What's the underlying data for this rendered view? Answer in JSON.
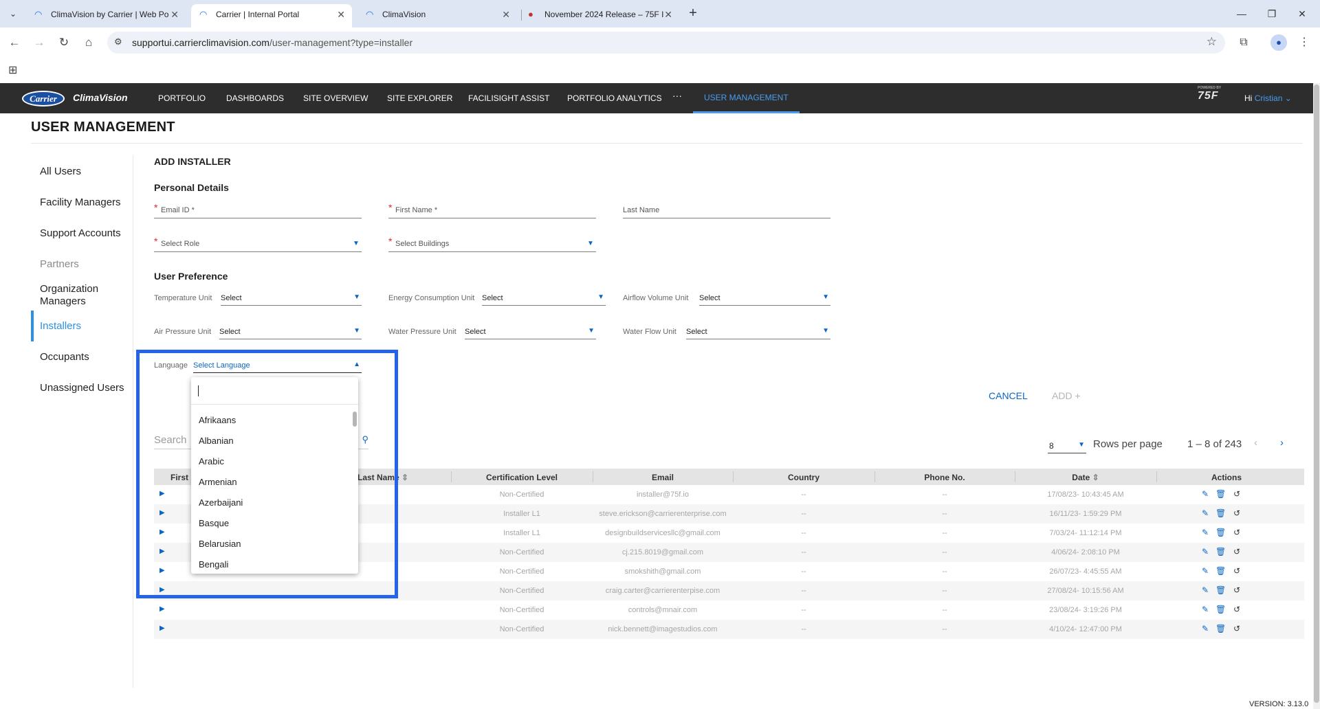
{
  "browser": {
    "tabs": [
      {
        "title": "ClimaVision by Carrier | Web Po",
        "active": false
      },
      {
        "title": "Carrier | Internal Portal",
        "active": true
      },
      {
        "title": "ClimaVision",
        "active": false
      },
      {
        "title": "November 2024 Release – 75F I",
        "active": false
      }
    ],
    "url_host": "supportui.carrierclimavision.com",
    "url_path": "/user-management?type=installer"
  },
  "app": {
    "logo_badge": "Carrier",
    "logo_text": "ClimaVision",
    "nav": [
      "PORTFOLIO",
      "DASHBOARDS",
      "SITE OVERVIEW",
      "SITE EXPLORER",
      "FACILISIGHT ASSIST",
      "PORTFOLIO ANALYTICS",
      "USER MANAGEMENT"
    ],
    "nav_more": "···",
    "active_nav": "USER MANAGEMENT",
    "brand_small": "POWERED BY",
    "brand": "75F",
    "greeting": "Hi",
    "user": "Cristian"
  },
  "page_title": "USER MANAGEMENT",
  "sidebar": {
    "items": [
      "All Users",
      "Facility Managers",
      "Support Accounts",
      "Partners",
      "Organization Managers",
      "Installers",
      "Occupants",
      "Unassigned Users"
    ],
    "active": "Installers"
  },
  "form": {
    "title": "ADD INSTALLER",
    "personal_heading": "Personal Details",
    "email_label": "Email ID *",
    "first_name_label": "First Name *",
    "last_name_label": "Last Name",
    "role_label": "Select Role",
    "buildings_label": "Select Buildings",
    "pref_heading": "User Preference",
    "temp_label": "Temperature Unit",
    "energy_label": "Energy Consumption Unit",
    "airflow_label": "Airflow Volume Unit",
    "air_pressure_label": "Air Pressure Unit",
    "water_pressure_label": "Water Pressure Unit",
    "water_flow_label": "Water Flow Unit",
    "select_value": "Select",
    "language_label": "Language",
    "language_value": "Select Language",
    "cancel": "CANCEL",
    "add": "ADD +"
  },
  "language_options": [
    "Afrikaans",
    "Albanian",
    "Arabic",
    "Armenian",
    "Azerbaijani",
    "Basque",
    "Belarusian",
    "Bengali"
  ],
  "table_controls": {
    "search_placeholder": "Search",
    "rows_per_page_value": "8",
    "rows_per_page_label": "Rows per page",
    "range": "1 – 8 of 243"
  },
  "table": {
    "headers": [
      "First N",
      "Last Name",
      "Certification Level",
      "Email",
      "Country",
      "Phone No.",
      "Date",
      "Actions"
    ],
    "rows": [
      {
        "cert": "Non-Certified",
        "email": "installer@75f.io",
        "country": "--",
        "phone": "--",
        "date": "17/08/23- 10:43:45 AM"
      },
      {
        "cert": "Installer L1",
        "email": "steve.erickson@carrierenterprise.com",
        "country": "--",
        "phone": "--",
        "date": "16/11/23- 1:59:29 PM"
      },
      {
        "cert": "Installer L1",
        "email": "designbuildservicesllc@gmail.com",
        "country": "--",
        "phone": "--",
        "date": "7/03/24- 11:12:14 PM"
      },
      {
        "cert": "Non-Certified",
        "email": "cj.215.8019@gmail.com",
        "country": "--",
        "phone": "--",
        "date": "4/06/24- 2:08:10 PM"
      },
      {
        "cert": "Non-Certified",
        "email": "smokshith@gmail.com",
        "country": "--",
        "phone": "--",
        "date": "26/07/23- 4:45:55 AM"
      },
      {
        "cert": "Non-Certified",
        "email": "craig.carter@carrierenterpise.com",
        "country": "--",
        "phone": "--",
        "date": "27/08/24- 10:15:56 AM"
      },
      {
        "cert": "Non-Certified",
        "email": "controls@mnair.com",
        "country": "--",
        "phone": "--",
        "date": "23/08/24- 3:19:26 PM"
      },
      {
        "cert": "Non-Certified",
        "email": "nick.bennett@imagestudios.com",
        "country": "--",
        "phone": "--",
        "date": "4/10/24- 12:47:00 PM"
      }
    ]
  },
  "version": "VERSION: 3.13.0",
  "colors": {
    "accent": "#2c8fe6",
    "link": "#0b66c3",
    "highlight": "#2563eb",
    "required": "#e0262d",
    "appbar": "#2d2d2d"
  }
}
